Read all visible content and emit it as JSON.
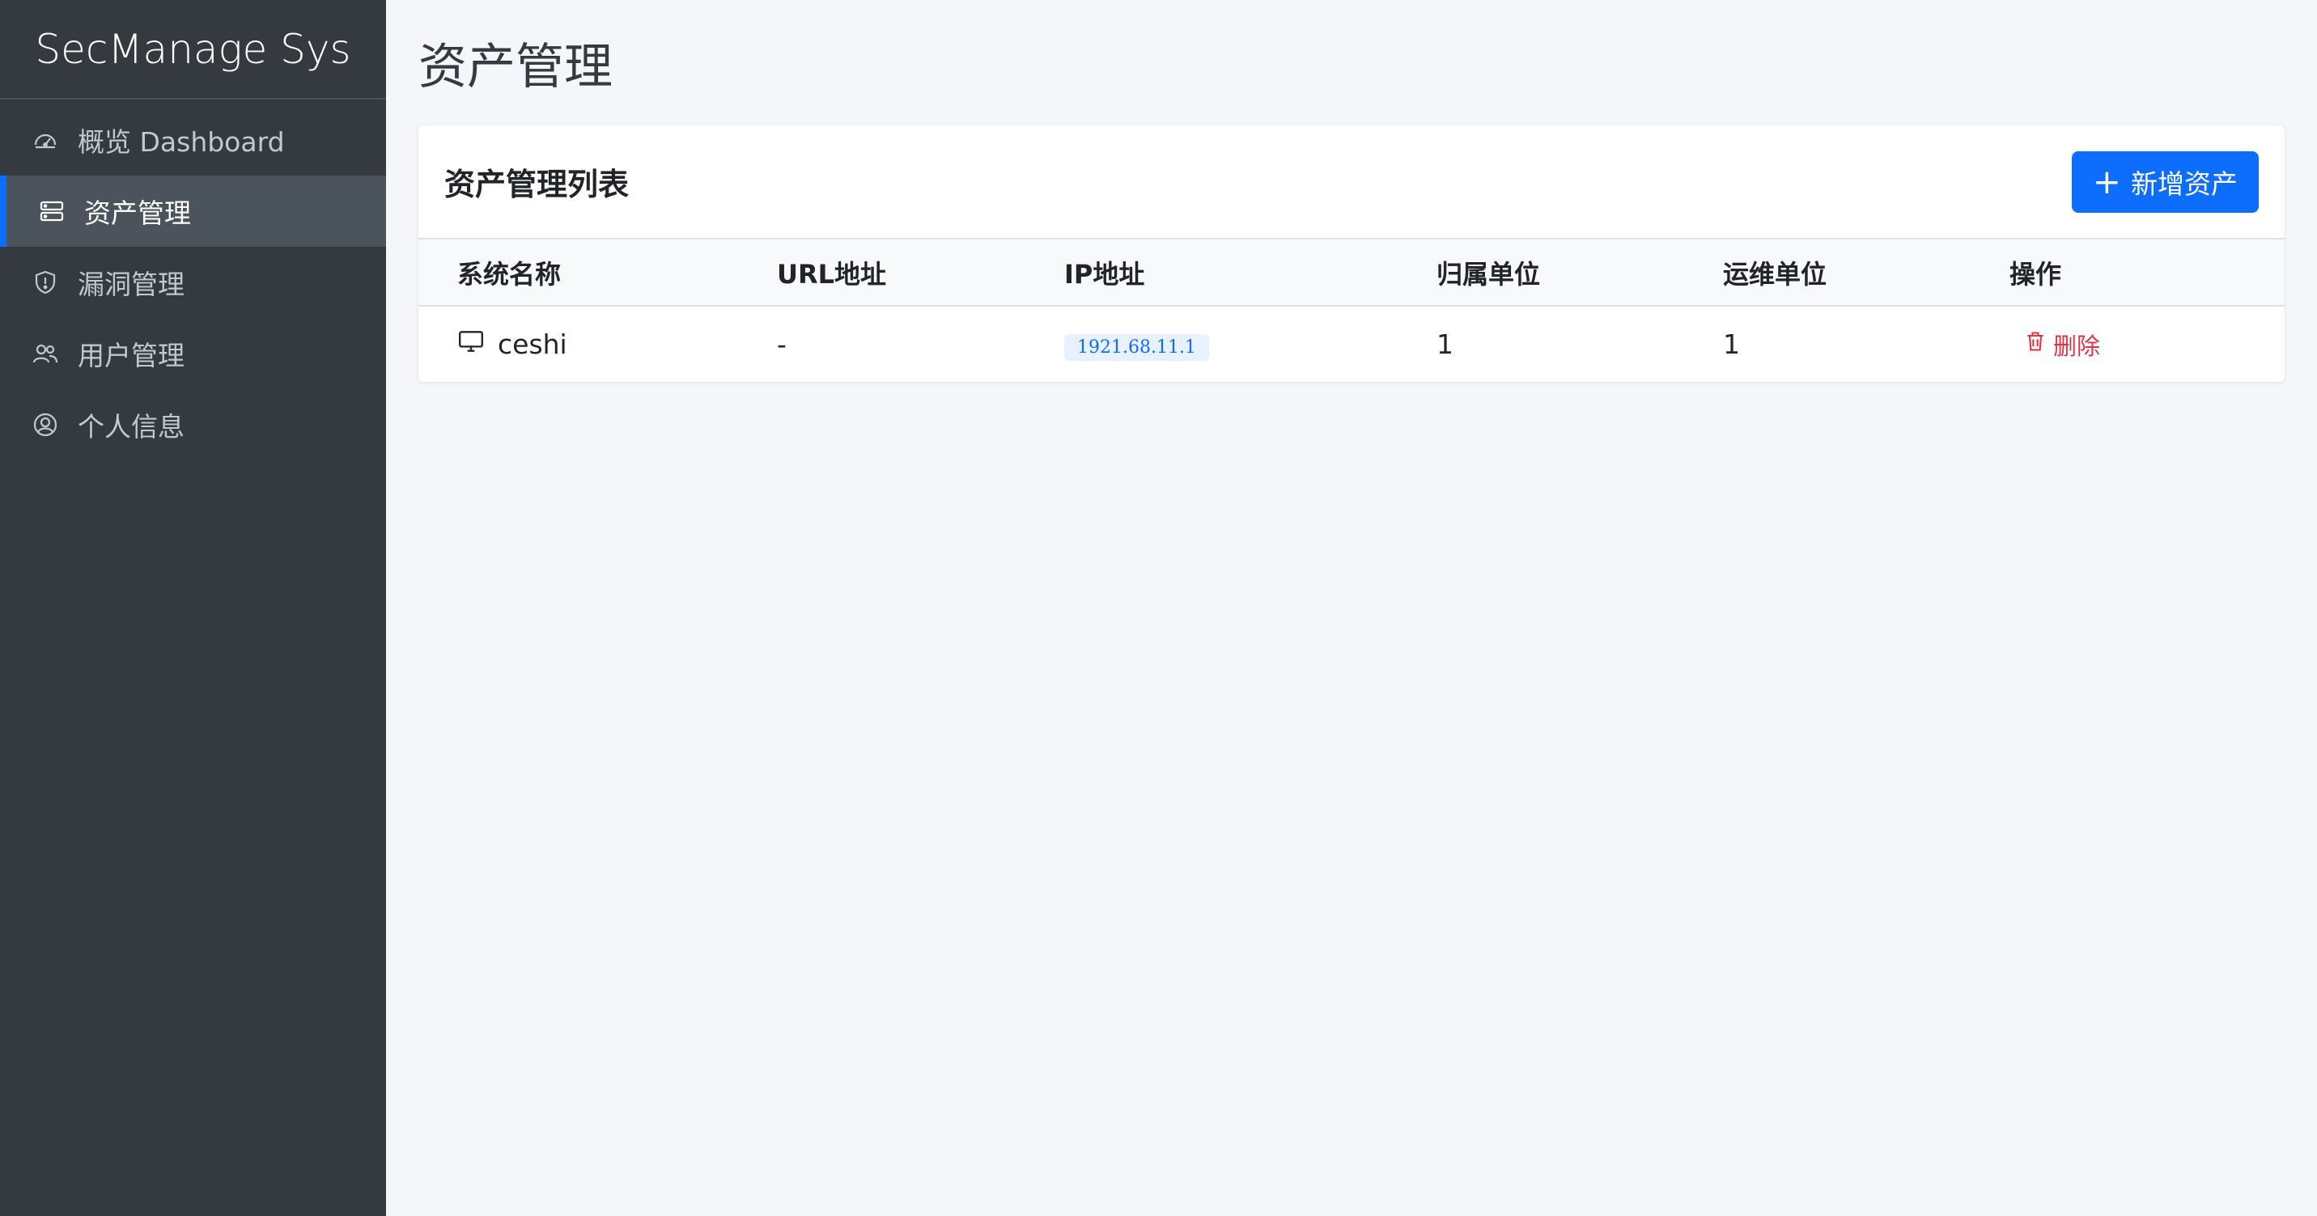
{
  "brand": "SecManage Sys",
  "sidebar": {
    "items": [
      {
        "label": "概览 Dashboard",
        "icon": "speedometer-icon"
      },
      {
        "label": "资产管理",
        "icon": "server-icon",
        "active": true
      },
      {
        "label": "漏洞管理",
        "icon": "shield-icon"
      },
      {
        "label": "用户管理",
        "icon": "users-icon"
      },
      {
        "label": "个人信息",
        "icon": "user-circle-icon"
      }
    ]
  },
  "page": {
    "title": "资产管理"
  },
  "card": {
    "title": "资产管理列表",
    "add_button": "新增资产"
  },
  "table": {
    "headers": [
      "系统名称",
      "URL地址",
      "IP地址",
      "归属单位",
      "运维单位",
      "操作"
    ],
    "rows": [
      {
        "name": "ceshi",
        "url": "-",
        "ip": "1921.68.11.1",
        "owner": "1",
        "ops": "1",
        "action": "删除"
      }
    ]
  },
  "colors": {
    "sidebar_bg": "#343a40",
    "accent": "#0d6efd",
    "danger": "#dc3545",
    "page_bg": "#f4f6f9"
  }
}
